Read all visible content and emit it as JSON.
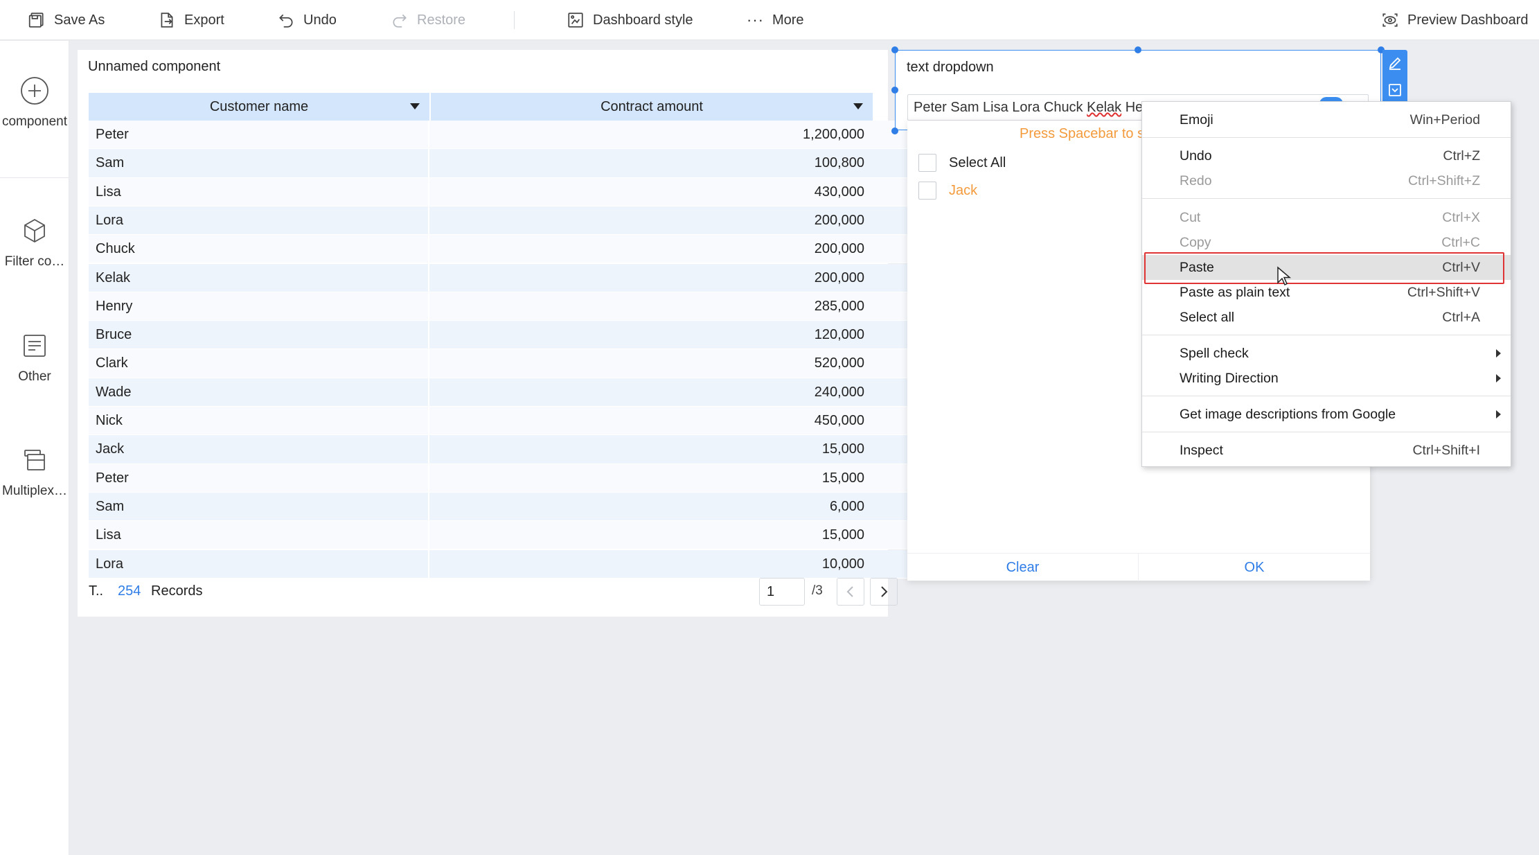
{
  "toolbar": {
    "save_as": "Save As",
    "export": "Export",
    "undo": "Undo",
    "restore": "Restore",
    "dashboard_style": "Dashboard style",
    "more": "More",
    "preview": "Preview Dashboard"
  },
  "sidebar": {
    "items": [
      {
        "label": "component",
        "icon": "plus-circle-icon"
      },
      {
        "label": "Filter co…",
        "icon": "cube-icon"
      },
      {
        "label": "Other",
        "icon": "document-icon"
      },
      {
        "label": "Multiplex…",
        "icon": "layers-icon"
      }
    ]
  },
  "table_card": {
    "title": "Unnamed component",
    "columns": [
      "Customer name",
      "Contract amount"
    ],
    "rows": [
      {
        "name": "Peter",
        "amount": "1,200,000"
      },
      {
        "name": "Sam",
        "amount": "100,800"
      },
      {
        "name": "Lisa",
        "amount": "430,000"
      },
      {
        "name": "Lora",
        "amount": "200,000"
      },
      {
        "name": "Chuck",
        "amount": "200,000"
      },
      {
        "name": "Kelak",
        "amount": "200,000"
      },
      {
        "name": "Henry",
        "amount": "285,000"
      },
      {
        "name": "Bruce",
        "amount": "120,000"
      },
      {
        "name": "Clark",
        "amount": "520,000"
      },
      {
        "name": "Wade",
        "amount": "240,000"
      },
      {
        "name": "Nick",
        "amount": "450,000"
      },
      {
        "name": "Jack",
        "amount": "15,000"
      },
      {
        "name": "Peter",
        "amount": "15,000"
      },
      {
        "name": "Sam",
        "amount": "6,000"
      },
      {
        "name": "Lisa",
        "amount": "15,000"
      },
      {
        "name": "Lora",
        "amount": "10,000"
      }
    ],
    "footer": {
      "total_prefix": "T..",
      "count": "254",
      "records": "Records",
      "page": "1",
      "page_total": "/3"
    }
  },
  "dropdown": {
    "title": "text dropdown",
    "value_a": "Peter Sam Lisa Lora Chuck ",
    "value_b": "Kelak",
    "value_c": " He",
    "hint": "Press Spacebar to s",
    "select_all": "Select All",
    "option": "Jack",
    "clear": "Clear",
    "ok": "OK",
    "accent": "#3b8ef0",
    "hint_color": "#f39b3c"
  },
  "context_menu": {
    "items": [
      {
        "label": "Emoji",
        "shortcut": "Win+Period"
      },
      {
        "label": "Undo",
        "shortcut": "Ctrl+Z"
      },
      {
        "label": "Redo",
        "shortcut": "Ctrl+Shift+Z"
      },
      {
        "label": "Cut",
        "shortcut": "Ctrl+X"
      },
      {
        "label": "Copy",
        "shortcut": "Ctrl+C"
      },
      {
        "label": "Paste",
        "shortcut": "Ctrl+V"
      },
      {
        "label": "Paste as plain text",
        "shortcut": "Ctrl+Shift+V"
      },
      {
        "label": "Select all",
        "shortcut": "Ctrl+A"
      },
      {
        "label": "Spell check",
        "shortcut": ""
      },
      {
        "label": "Writing Direction",
        "shortcut": ""
      },
      {
        "label": "Get image descriptions from Google",
        "shortcut": ""
      },
      {
        "label": "Inspect",
        "shortcut": "Ctrl+Shift+I"
      }
    ],
    "highlight_color": "#e03434"
  }
}
